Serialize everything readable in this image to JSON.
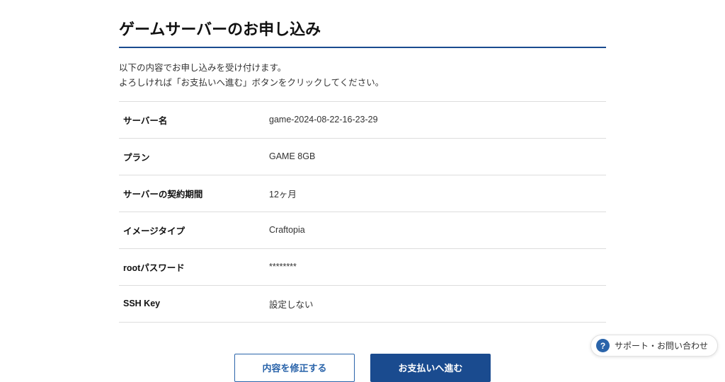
{
  "page": {
    "title": "ゲームサーバーのお申し込み",
    "intro_line1": "以下の内容でお申し込みを受け付けます。",
    "intro_line2": "よろしければ「お支払いへ進む」ボタンをクリックしてください。"
  },
  "fields": {
    "server_name": {
      "label": "サーバー名",
      "value": "game-2024-08-22-16-23-29"
    },
    "plan": {
      "label": "プラン",
      "value": "GAME 8GB"
    },
    "contract_period": {
      "label": "サーバーの契約期間",
      "value": "12ヶ月"
    },
    "image_type": {
      "label": "イメージタイプ",
      "value": "Craftopia"
    },
    "root_password": {
      "label": "rootパスワード",
      "value": "********"
    },
    "ssh_key": {
      "label": "SSH Key",
      "value": "設定しない"
    }
  },
  "actions": {
    "edit": "内容を修正する",
    "proceed": "お支払いへ進む"
  },
  "support": {
    "label": "サポート・お問い合わせ",
    "glyph": "?"
  }
}
